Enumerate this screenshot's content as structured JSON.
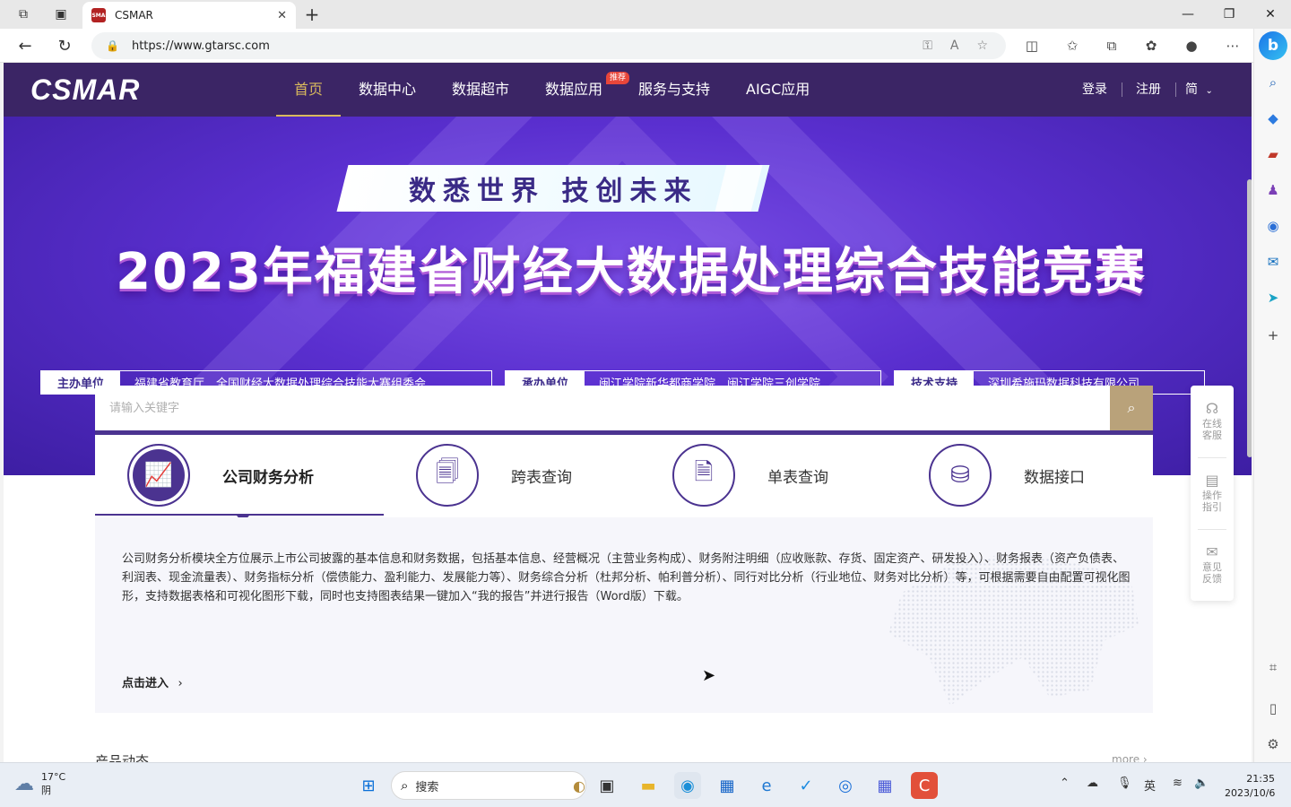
{
  "browser": {
    "tab_title": "CSMAR",
    "favicon_text": "CSMAR",
    "url": "https://www.gtarsc.com"
  },
  "site": {
    "logo": "CSMAR",
    "nav": [
      "首页",
      "数据中心",
      "数据超市",
      "数据应用",
      "服务与支持",
      "AIGC应用"
    ],
    "nav_badge": "推荐",
    "login": "登录",
    "register": "注册",
    "language": "简"
  },
  "banner": {
    "slogan": "数悉世界 技创未来",
    "headline": "2023年福建省财经大数据处理综合技能竞赛",
    "orgs": [
      {
        "label": "主办单位",
        "text": "福建省教育厅　全国财经大数据处理综合技能大赛组委会"
      },
      {
        "label": "承办单位",
        "text": "闽江学院新华都商学院　闽江学院三创学院"
      },
      {
        "label": "技术支持",
        "text": "深圳希施玛数据科技有限公司"
      }
    ]
  },
  "search": {
    "placeholder": "请输入关键字"
  },
  "features": {
    "tabs": [
      "公司财务分析",
      "跨表查询",
      "单表查询",
      "数据接口"
    ],
    "description": "公司财务分析模块全方位展示上市公司披露的基本信息和财务数据，包括基本信息、经营概况（主营业务构成）、财务附注明细（应收账款、存货、固定资产、研发投入）、财务报表（资产负债表、利润表、现金流量表）、财务指标分析（偿债能力、盈利能力、发展能力等）、财务综合分析（杜邦分析、帕利普分析）、同行对比分析（行业地位、财务对比分析）等，可根据需要自由配置可视化图形，支持数据表格和可视化图形下载，同时也支持图表结果一键加入“我的报告”并进行报告（Word版）下载。",
    "enter_link": "点击进入"
  },
  "next_section": {
    "title": "产品动态",
    "more": "more"
  },
  "float_tools": [
    "在线客服",
    "操作指引",
    "意见反馈"
  ],
  "taskbar": {
    "weather_temp": "17°C",
    "weather_desc": "阴",
    "search_label": "搜索",
    "ime": "英",
    "time": "21:35",
    "date": "2023/10/6"
  },
  "colors": {
    "header_bg": "#3b2565",
    "accent_gold": "#d9b95d",
    "feature_purple": "#4b3390",
    "search_btn": "#b9a27a"
  }
}
